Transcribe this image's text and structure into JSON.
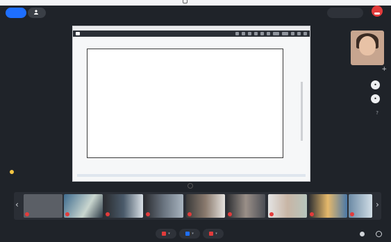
{
  "topbar": {
    "left_button": "",
    "mic_button": "",
    "right_pill": "",
    "leave_label": ""
  },
  "share": {
    "title": "",
    "page_indicator": ""
  },
  "caption": {
    "text": ""
  },
  "side": {
    "help": "?",
    "plus": "+"
  },
  "carousel": {
    "prev": "‹",
    "next": "›"
  },
  "participants": [
    {
      "name": ""
    },
    {
      "name": ""
    },
    {
      "name": ""
    },
    {
      "name": ""
    },
    {
      "name": ""
    },
    {
      "name": ""
    },
    {
      "name": ""
    },
    {
      "name": ""
    },
    {
      "name": ""
    },
    {
      "name": ""
    }
  ],
  "colors": {
    "accent": "#1e6fff",
    "danger": "#e23b3b",
    "background": "#1f2329"
  },
  "icons": [
    "user-icon",
    "phone-end-icon",
    "microphone-icon",
    "camera-icon",
    "screen-share-icon",
    "chevron-down-icon",
    "help-icon",
    "plus-icon"
  ]
}
